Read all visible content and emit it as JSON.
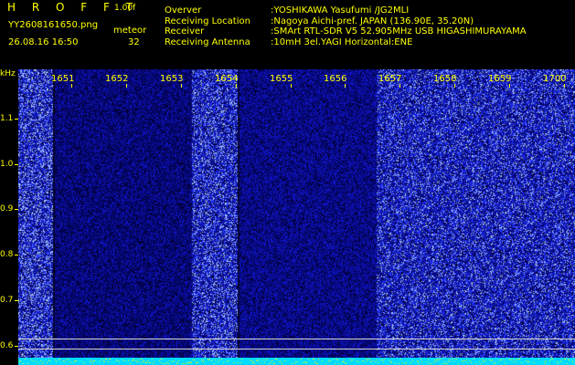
{
  "header": {
    "brand": "H R O F F T",
    "version": "1.00f",
    "filename": "YY2608161650.png",
    "datetime": "26.08.16 16:50",
    "meteor_label": "meteor",
    "meteor_count": "32",
    "info_labels": [
      "Overver",
      "Receiving Location",
      "Receiver",
      "Receiving Antenna"
    ],
    "info_values": [
      ":YOSHIKAWA Yasufumi /JG2MLI",
      ":Nagoya Aichi-pref. JAPAN (136.90E, 35.20N)",
      ":SMArt RTL-SDR V5 52.905MHz USB HIGASHIMURAYAMA",
      ":10mH 3el.YAGI Horizontal:ENE"
    ]
  },
  "axis": {
    "y_unit": "kHz",
    "y_ticks": [
      "1.1",
      "1.0",
      "0.9",
      "0.8",
      "0.7",
      "0.6"
    ],
    "x_ticks": [
      "1651",
      "1652",
      "1653",
      "1654",
      "1655",
      "1656",
      "1657",
      "1658",
      "1659",
      "1700"
    ]
  },
  "colors": {
    "text": "#ffff00",
    "background": "#000000",
    "waterfall_bright": "#3030ff",
    "waterfall_dim": "#10107a",
    "noise_strip": "#00e0ff"
  }
}
